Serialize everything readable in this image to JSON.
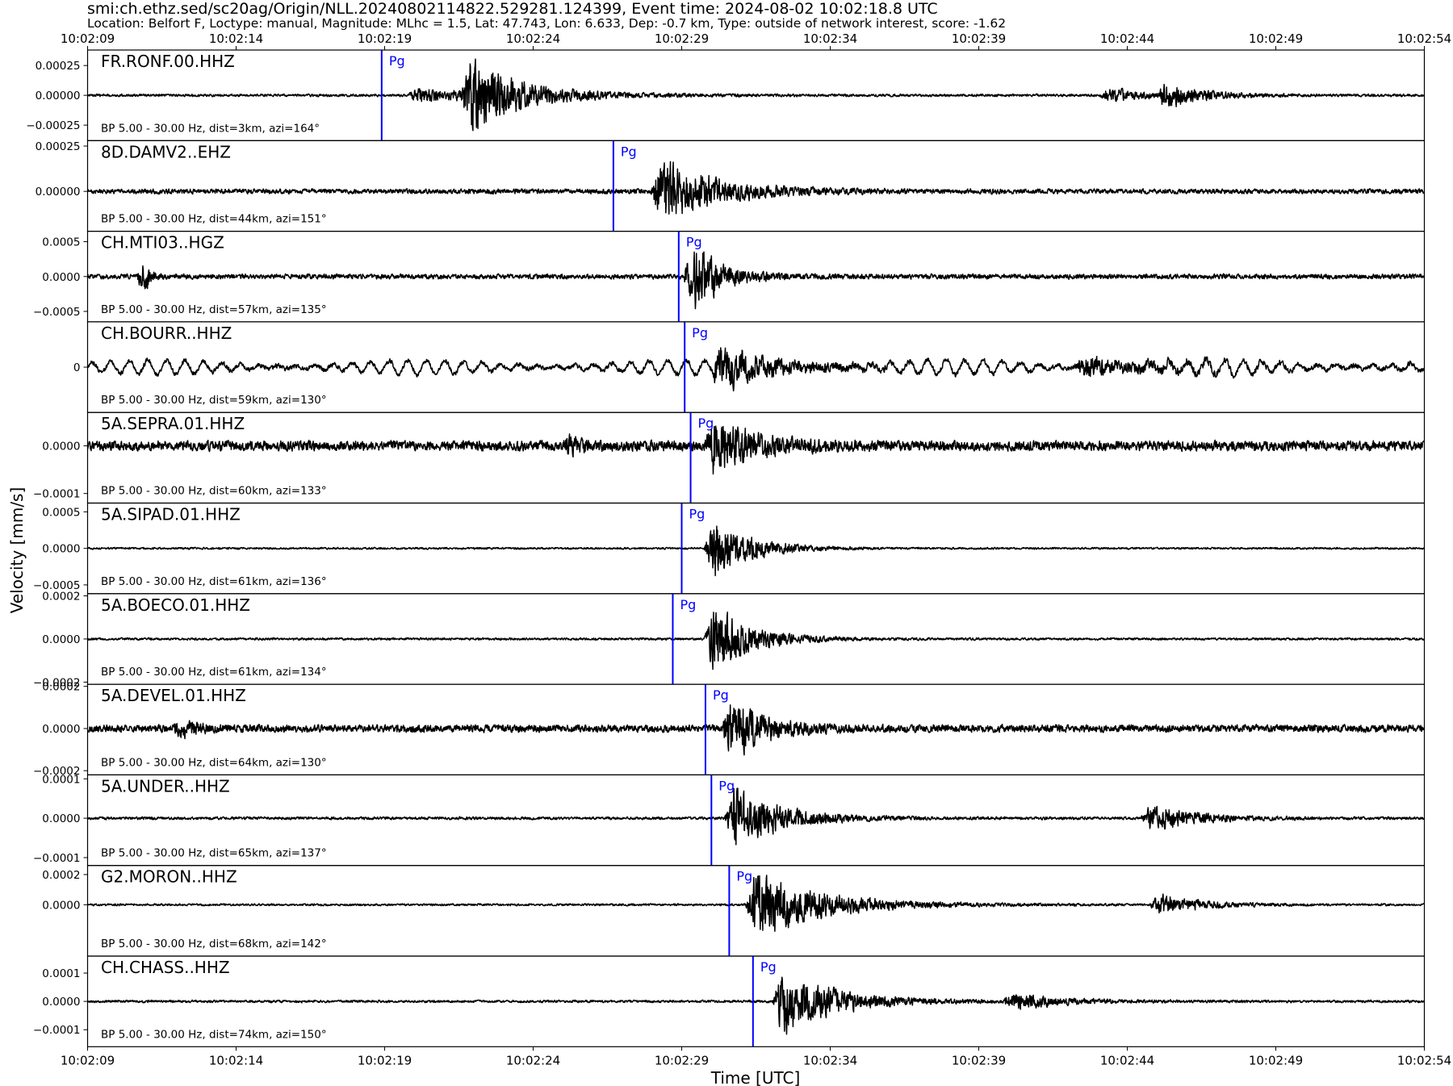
{
  "title": "smi:ch.ethz.sed/sc20ag/Origin/NLL.20240802114822.529281.124399, Event time: 2024-08-02 10:02:18.8 UTC",
  "subtitle": "Location: Belfort F, Loctype: manual, Magnitude: MLhc = 1.5, Lat: 47.743, Lon: 6.633, Dep: -0.7 km, Type: outside of network interest, score: -1.62",
  "colors": {
    "trace": "#000000",
    "pick": "#0000ff",
    "axis": "#000000"
  },
  "chart_data": {
    "type": "line",
    "xlabel": "Time [UTC]",
    "ylabel": "Velocity [mm/s]",
    "x_ticks": [
      "10:02:09",
      "10:02:14",
      "10:02:19",
      "10:02:24",
      "10:02:29",
      "10:02:34",
      "10:02:39",
      "10:02:44",
      "10:02:49",
      "10:02:54"
    ],
    "x_range_s": [
      0,
      45
    ],
    "grid": false,
    "panels": [
      {
        "station": "FR.RONF.00.HHZ",
        "filter": "BP 5.00 - 30.00 Hz, dist=3km, azi=164°",
        "pick": "Pg",
        "pick_time_s": 9.9,
        "y_ticks": [
          {
            "v": 0.00025,
            "label": "0.00025"
          },
          {
            "v": 0,
            "label": "0.00000"
          },
          {
            "v": -0.00025,
            "label": "−0.00025"
          }
        ],
        "ylim": [
          -0.00038,
          0.00038
        ],
        "noise": 1.2e-05,
        "peak": 0.00036,
        "bursts": [
          {
            "t": 11.0,
            "amp": 6e-05,
            "d": 3.0
          },
          {
            "t": 12.8,
            "amp": 0.00036,
            "d": 1.6
          },
          {
            "t": 34.3,
            "amp": 8e-05,
            "d": 1.0
          },
          {
            "t": 36.2,
            "amp": 0.00013,
            "d": 1.2
          }
        ],
        "wobble": 0
      },
      {
        "station": "8D.DAMV2..EHZ",
        "filter": "BP 5.00 - 30.00 Hz, dist=44km, azi=151°",
        "pick": "Pg",
        "pick_time_s": 17.7,
        "y_ticks": [
          {
            "v": 0.00025,
            "label": "0.00025"
          },
          {
            "v": 0,
            "label": "0.00000"
          }
        ],
        "ylim": [
          -0.00022,
          0.00028
        ],
        "noise": 1.5e-05,
        "peak": 0.00022,
        "bursts": [
          {
            "t": 19.2,
            "amp": 0.00022,
            "d": 1.8
          }
        ],
        "wobble": 0
      },
      {
        "station": "CH.MTI03..HGZ",
        "filter": "BP 5.00 - 30.00 Hz, dist=57km, azi=135°",
        "pick": "Pg",
        "pick_time_s": 19.9,
        "y_ticks": [
          {
            "v": 0.0005,
            "label": "0.0005"
          },
          {
            "v": 0,
            "label": "0.0000"
          },
          {
            "v": -0.0005,
            "label": "−0.0005"
          }
        ],
        "ylim": [
          -0.00065,
          0.00065
        ],
        "noise": 4e-05,
        "peak": 0.00062,
        "bursts": [
          {
            "t": 1.9,
            "amp": 0.00035,
            "d": 0.15
          },
          {
            "t": 20.3,
            "amp": 0.00062,
            "d": 0.9
          }
        ],
        "wobble": 0
      },
      {
        "station": "CH.BOURR..HHZ",
        "filter": "BP 5.00 - 30.00 Hz, dist=59km, azi=130°",
        "pick": "Pg",
        "pick_time_s": 20.1,
        "y_ticks": [
          {
            "v": 0,
            "label": "0"
          }
        ],
        "ylim": [
          -1,
          1
        ],
        "noise": 0.06,
        "peak": 0.5,
        "bursts": [
          {
            "t": 21.2,
            "amp": 0.5,
            "d": 1.8
          },
          {
            "t": 33.5,
            "amp": 0.22,
            "d": 2.5
          }
        ],
        "wobble": 0.16
      },
      {
        "station": "5A.SEPRA.01.HHZ",
        "filter": "BP 5.00 - 30.00 Hz, dist=60km, azi=133°",
        "pick": "Pg",
        "pick_time_s": 20.3,
        "y_ticks": [
          {
            "v": 0,
            "label": "0.0000"
          },
          {
            "v": -0.0001,
            "label": "−0.0001"
          }
        ],
        "ylim": [
          -0.00012,
          7e-05
        ],
        "noise": 1.2e-05,
        "peak": 7e-05,
        "bursts": [
          {
            "t": 16.2,
            "amp": 2e-05,
            "d": 0.5
          },
          {
            "t": 21.0,
            "amp": 7e-05,
            "d": 1.4
          }
        ],
        "wobble": 0
      },
      {
        "station": "5A.SIPAD.01.HHZ",
        "filter": "BP 5.00 - 30.00 Hz, dist=61km, azi=136°",
        "pick": "Pg",
        "pick_time_s": 20.0,
        "y_ticks": [
          {
            "v": 0.0005,
            "label": "0.0005"
          },
          {
            "v": 0,
            "label": "0.0000"
          },
          {
            "v": -0.0005,
            "label": "−0.0005"
          }
        ],
        "ylim": [
          -0.00062,
          0.00062
        ],
        "noise": 1.5e-05,
        "peak": 0.00055,
        "bursts": [
          {
            "t": 21.0,
            "amp": 0.00055,
            "d": 1.2
          }
        ],
        "wobble": 0
      },
      {
        "station": "5A.BOECO.01.HHZ",
        "filter": "BP 5.00 - 30.00 Hz, dist=61km, azi=134°",
        "pick": "Pg",
        "pick_time_s": 19.7,
        "y_ticks": [
          {
            "v": 0.0002,
            "label": "0.0002"
          },
          {
            "v": 0,
            "label": "0.0000"
          },
          {
            "v": -0.0002,
            "label": "−0.0002"
          }
        ],
        "ylim": [
          -0.00021,
          0.00021
        ],
        "noise": 6e-06,
        "peak": 0.00018,
        "bursts": [
          {
            "t": 21.0,
            "amp": 0.00018,
            "d": 1.3
          }
        ],
        "wobble": 0
      },
      {
        "station": "5A.DEVEL.01.HHZ",
        "filter": "BP 5.00 - 30.00 Hz, dist=64km, azi=130°",
        "pick": "Pg",
        "pick_time_s": 20.8,
        "y_ticks": [
          {
            "v": 0.0002,
            "label": "0.0002"
          },
          {
            "v": 0,
            "label": "0.0000"
          },
          {
            "v": -0.0002,
            "label": "−0.0002"
          }
        ],
        "ylim": [
          -0.00022,
          0.00021
        ],
        "noise": 2e-05,
        "peak": 0.0002,
        "bursts": [
          {
            "t": 3.1,
            "amp": 5e-05,
            "d": 0.5
          },
          {
            "t": 21.6,
            "amp": 0.0002,
            "d": 1.0
          }
        ],
        "wobble": 0
      },
      {
        "station": "5A.UNDER..HHZ",
        "filter": "BP 5.00 - 30.00 Hz, dist=65km, azi=137°",
        "pick": "Pg",
        "pick_time_s": 21.0,
        "y_ticks": [
          {
            "v": 0.0001,
            "label": "0.0001"
          },
          {
            "v": 0,
            "label": "0.0000"
          },
          {
            "v": -0.0001,
            "label": "−0.0001"
          }
        ],
        "ylim": [
          -0.00012,
          0.00011
        ],
        "noise": 4e-06,
        "peak": 0.0001,
        "bursts": [
          {
            "t": 21.7,
            "amp": 0.0001,
            "d": 1.5
          },
          {
            "t": 35.7,
            "amp": 4e-05,
            "d": 1.5
          }
        ],
        "wobble": 0
      },
      {
        "station": "G2.MORON..HHZ",
        "filter": "BP 5.00 - 30.00 Hz, dist=68km, azi=142°",
        "pick": "Pg",
        "pick_time_s": 21.6,
        "y_ticks": [
          {
            "v": 0.0002,
            "label": "0.0002"
          },
          {
            "v": 0,
            "label": "0.0000"
          }
        ],
        "ylim": [
          -0.00034,
          0.00026
        ],
        "noise": 8e-06,
        "peak": 0.00026,
        "bursts": [
          {
            "t": 22.4,
            "amp": 0.00026,
            "d": 2.2
          },
          {
            "t": 36.0,
            "amp": 8e-05,
            "d": 1.4
          }
        ],
        "wobble": 0
      },
      {
        "station": "CH.CHASS..HHZ",
        "filter": "BP 5.00 - 30.00 Hz, dist=74km, azi=150°",
        "pick": "Pg",
        "pick_time_s": 22.4,
        "y_ticks": [
          {
            "v": 0.0001,
            "label": "0.0001"
          },
          {
            "v": 0,
            "label": "0.0000"
          },
          {
            "v": -0.0001,
            "label": "−0.0001"
          }
        ],
        "ylim": [
          -0.00016,
          0.00016
        ],
        "noise": 5e-06,
        "peak": 0.00013,
        "bursts": [
          {
            "t": 23.3,
            "amp": 0.00013,
            "d": 1.8
          },
          {
            "t": 31.0,
            "amp": 3e-05,
            "d": 1.8
          }
        ],
        "wobble": 0
      }
    ]
  }
}
